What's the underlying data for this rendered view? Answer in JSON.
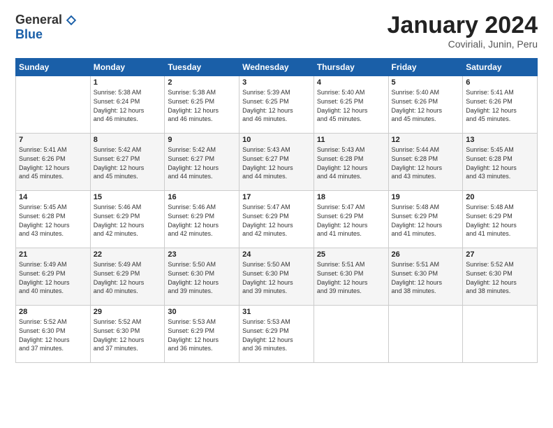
{
  "logo": {
    "general": "General",
    "blue": "Blue"
  },
  "header": {
    "month": "January 2024",
    "location": "Coviriali, Junin, Peru"
  },
  "weekdays": [
    "Sunday",
    "Monday",
    "Tuesday",
    "Wednesday",
    "Thursday",
    "Friday",
    "Saturday"
  ],
  "weeks": [
    [
      {
        "day": "",
        "info": ""
      },
      {
        "day": "1",
        "info": "Sunrise: 5:38 AM\nSunset: 6:24 PM\nDaylight: 12 hours\nand 46 minutes."
      },
      {
        "day": "2",
        "info": "Sunrise: 5:38 AM\nSunset: 6:25 PM\nDaylight: 12 hours\nand 46 minutes."
      },
      {
        "day": "3",
        "info": "Sunrise: 5:39 AM\nSunset: 6:25 PM\nDaylight: 12 hours\nand 46 minutes."
      },
      {
        "day": "4",
        "info": "Sunrise: 5:40 AM\nSunset: 6:25 PM\nDaylight: 12 hours\nand 45 minutes."
      },
      {
        "day": "5",
        "info": "Sunrise: 5:40 AM\nSunset: 6:26 PM\nDaylight: 12 hours\nand 45 minutes."
      },
      {
        "day": "6",
        "info": "Sunrise: 5:41 AM\nSunset: 6:26 PM\nDaylight: 12 hours\nand 45 minutes."
      }
    ],
    [
      {
        "day": "7",
        "info": "Sunrise: 5:41 AM\nSunset: 6:26 PM\nDaylight: 12 hours\nand 45 minutes."
      },
      {
        "day": "8",
        "info": "Sunrise: 5:42 AM\nSunset: 6:27 PM\nDaylight: 12 hours\nand 45 minutes."
      },
      {
        "day": "9",
        "info": "Sunrise: 5:42 AM\nSunset: 6:27 PM\nDaylight: 12 hours\nand 44 minutes."
      },
      {
        "day": "10",
        "info": "Sunrise: 5:43 AM\nSunset: 6:27 PM\nDaylight: 12 hours\nand 44 minutes."
      },
      {
        "day": "11",
        "info": "Sunrise: 5:43 AM\nSunset: 6:28 PM\nDaylight: 12 hours\nand 44 minutes."
      },
      {
        "day": "12",
        "info": "Sunrise: 5:44 AM\nSunset: 6:28 PM\nDaylight: 12 hours\nand 43 minutes."
      },
      {
        "day": "13",
        "info": "Sunrise: 5:45 AM\nSunset: 6:28 PM\nDaylight: 12 hours\nand 43 minutes."
      }
    ],
    [
      {
        "day": "14",
        "info": "Sunrise: 5:45 AM\nSunset: 6:28 PM\nDaylight: 12 hours\nand 43 minutes."
      },
      {
        "day": "15",
        "info": "Sunrise: 5:46 AM\nSunset: 6:29 PM\nDaylight: 12 hours\nand 42 minutes."
      },
      {
        "day": "16",
        "info": "Sunrise: 5:46 AM\nSunset: 6:29 PM\nDaylight: 12 hours\nand 42 minutes."
      },
      {
        "day": "17",
        "info": "Sunrise: 5:47 AM\nSunset: 6:29 PM\nDaylight: 12 hours\nand 42 minutes."
      },
      {
        "day": "18",
        "info": "Sunrise: 5:47 AM\nSunset: 6:29 PM\nDaylight: 12 hours\nand 41 minutes."
      },
      {
        "day": "19",
        "info": "Sunrise: 5:48 AM\nSunset: 6:29 PM\nDaylight: 12 hours\nand 41 minutes."
      },
      {
        "day": "20",
        "info": "Sunrise: 5:48 AM\nSunset: 6:29 PM\nDaylight: 12 hours\nand 41 minutes."
      }
    ],
    [
      {
        "day": "21",
        "info": "Sunrise: 5:49 AM\nSunset: 6:29 PM\nDaylight: 12 hours\nand 40 minutes."
      },
      {
        "day": "22",
        "info": "Sunrise: 5:49 AM\nSunset: 6:29 PM\nDaylight: 12 hours\nand 40 minutes."
      },
      {
        "day": "23",
        "info": "Sunrise: 5:50 AM\nSunset: 6:30 PM\nDaylight: 12 hours\nand 39 minutes."
      },
      {
        "day": "24",
        "info": "Sunrise: 5:50 AM\nSunset: 6:30 PM\nDaylight: 12 hours\nand 39 minutes."
      },
      {
        "day": "25",
        "info": "Sunrise: 5:51 AM\nSunset: 6:30 PM\nDaylight: 12 hours\nand 39 minutes."
      },
      {
        "day": "26",
        "info": "Sunrise: 5:51 AM\nSunset: 6:30 PM\nDaylight: 12 hours\nand 38 minutes."
      },
      {
        "day": "27",
        "info": "Sunrise: 5:52 AM\nSunset: 6:30 PM\nDaylight: 12 hours\nand 38 minutes."
      }
    ],
    [
      {
        "day": "28",
        "info": "Sunrise: 5:52 AM\nSunset: 6:30 PM\nDaylight: 12 hours\nand 37 minutes."
      },
      {
        "day": "29",
        "info": "Sunrise: 5:52 AM\nSunset: 6:30 PM\nDaylight: 12 hours\nand 37 minutes."
      },
      {
        "day": "30",
        "info": "Sunrise: 5:53 AM\nSunset: 6:29 PM\nDaylight: 12 hours\nand 36 minutes."
      },
      {
        "day": "31",
        "info": "Sunrise: 5:53 AM\nSunset: 6:29 PM\nDaylight: 12 hours\nand 36 minutes."
      },
      {
        "day": "",
        "info": ""
      },
      {
        "day": "",
        "info": ""
      },
      {
        "day": "",
        "info": ""
      }
    ]
  ]
}
